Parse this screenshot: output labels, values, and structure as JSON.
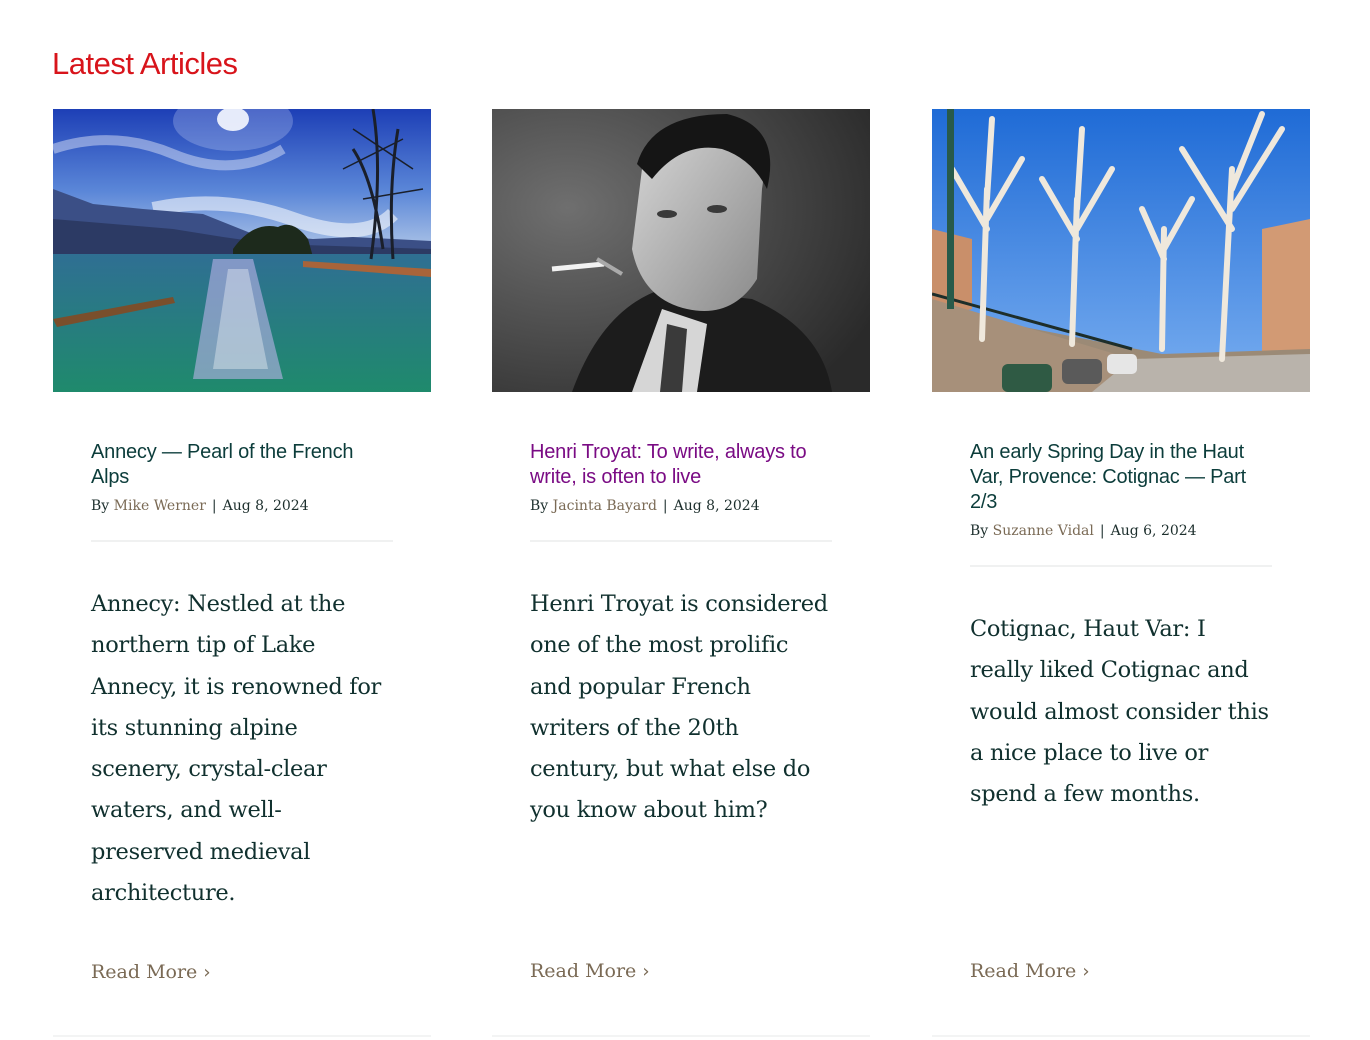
{
  "section": {
    "title": "Latest Articles"
  },
  "articles": [
    {
      "title": "Annecy — Pearl of the French Alps",
      "by": "By",
      "author": "Mike Werner",
      "date": "Aug 8, 2024",
      "excerpt": "Annecy: Nestled at the northern tip of Lake Annecy, it is renowned for its stunning alpine scenery, crystal-clear waters, and well-preserved medieval architecture.",
      "read_more": "Read More",
      "image": "lake-annecy-photo"
    },
    {
      "title": "Henri Troyat: To write, always to write, is often to live",
      "by": "By",
      "author": "Jacinta Bayard",
      "date": "Aug 8, 2024",
      "excerpt": "Henri Troyat is considered one of the most prolific and popular French writers of the 20th century, but what else do you know about him?",
      "read_more": "Read More",
      "image": "henri-troyat-portrait-photo",
      "title_color": "#7a0b84"
    },
    {
      "title": "An early Spring Day in the Haut Var, Provence: Cotignac — Part 2/3",
      "by": "By",
      "author": "Suzanne Vidal",
      "date": "Aug 6, 2024",
      "excerpt": "Cotignac, Haut Var: I really liked Cotignac and would almost consider this a nice place to live or spend a few months.",
      "read_more": "Read More",
      "image": "cotignac-street-photo"
    }
  ],
  "colors": {
    "section_title": "#d8141b",
    "article_title": "#0c3d3b",
    "visited_title": "#7a0b84",
    "author_link": "#7a6a55",
    "read_more": "#7a6a55",
    "body_text": "#10302e"
  }
}
